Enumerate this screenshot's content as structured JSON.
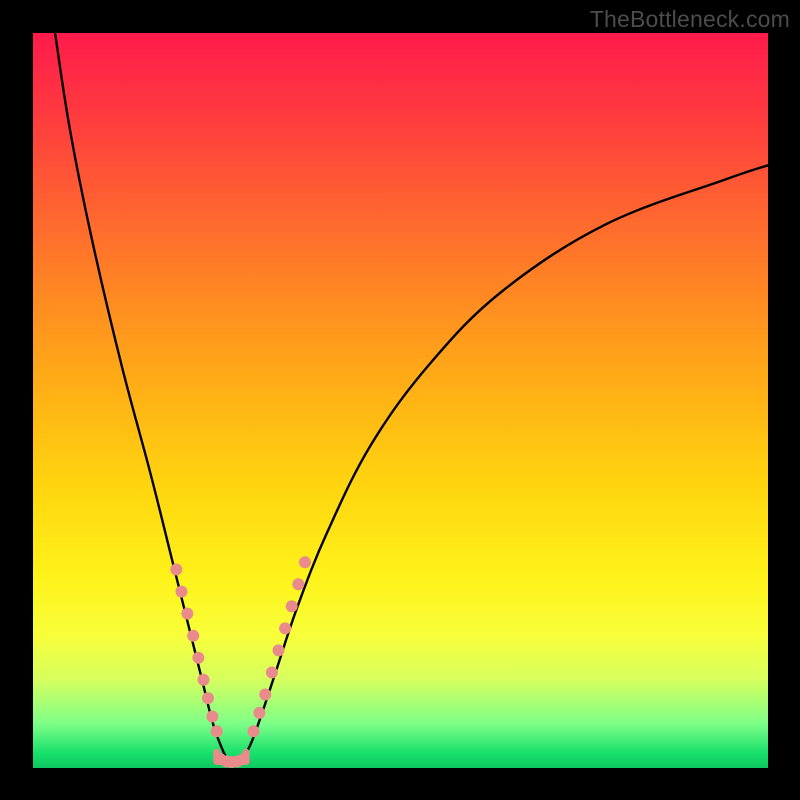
{
  "watermark": "TheBottleneck.com",
  "chart_data": {
    "type": "line",
    "title": "",
    "xlabel": "",
    "ylabel": "",
    "xlim": [
      0,
      100
    ],
    "ylim": [
      0,
      100
    ],
    "note": "Two curves descending from top into a V-shaped minimum near x≈27; left branch from top-left, right branch ascending toward upper-right. Values estimated from pixels.",
    "series": [
      {
        "name": "left-branch",
        "x": [
          3,
          5,
          8,
          12,
          16,
          19,
          21,
          23,
          24.5,
          26,
          27
        ],
        "y": [
          100,
          87,
          72,
          55,
          40,
          28,
          20,
          12,
          6,
          2,
          0.5
        ]
      },
      {
        "name": "right-branch",
        "x": [
          28,
          29.5,
          31,
          33,
          36,
          40,
          46,
          54,
          64,
          78,
          94,
          100
        ],
        "y": [
          0.5,
          3,
          7,
          13,
          22,
          32,
          44,
          55,
          65,
          74,
          80,
          82
        ]
      }
    ],
    "markers": {
      "color": "#e98b8b",
      "radius_px": 6,
      "note": "Pink dots clustered along both branches near the valley and a short flat segment at the very bottom.",
      "points": [
        {
          "branch": "left",
          "x": 19.5,
          "y": 27
        },
        {
          "branch": "left",
          "x": 20.2,
          "y": 24
        },
        {
          "branch": "left",
          "x": 21.0,
          "y": 21
        },
        {
          "branch": "left",
          "x": 21.8,
          "y": 18
        },
        {
          "branch": "left",
          "x": 22.5,
          "y": 15
        },
        {
          "branch": "left",
          "x": 23.2,
          "y": 12
        },
        {
          "branch": "left",
          "x": 23.8,
          "y": 9.5
        },
        {
          "branch": "left",
          "x": 24.4,
          "y": 7
        },
        {
          "branch": "left",
          "x": 25.0,
          "y": 5
        },
        {
          "branch": "right",
          "x": 30.0,
          "y": 5
        },
        {
          "branch": "right",
          "x": 30.8,
          "y": 7.5
        },
        {
          "branch": "right",
          "x": 31.6,
          "y": 10
        },
        {
          "branch": "right",
          "x": 32.5,
          "y": 13
        },
        {
          "branch": "right",
          "x": 33.4,
          "y": 16
        },
        {
          "branch": "right",
          "x": 34.3,
          "y": 19
        },
        {
          "branch": "right",
          "x": 35.2,
          "y": 22
        },
        {
          "branch": "right",
          "x": 36.1,
          "y": 25
        },
        {
          "branch": "right",
          "x": 37.0,
          "y": 28
        },
        {
          "branch": "bottom",
          "x": 25.5,
          "y": 1.2
        },
        {
          "branch": "bottom",
          "x": 26.3,
          "y": 0.9
        },
        {
          "branch": "bottom",
          "x": 27.0,
          "y": 0.8
        },
        {
          "branch": "bottom",
          "x": 27.8,
          "y": 0.9
        },
        {
          "branch": "bottom",
          "x": 28.6,
          "y": 1.2
        }
      ]
    },
    "bottom_bracket": {
      "color": "#e98b8b",
      "stroke_px": 7,
      "x_from": 25.0,
      "x_to": 29.0,
      "y": 0.9
    }
  }
}
